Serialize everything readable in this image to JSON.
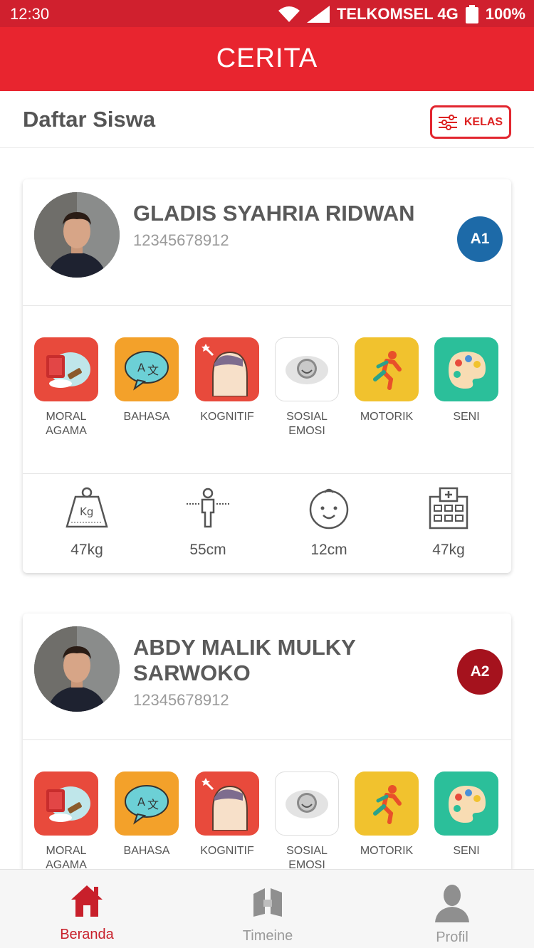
{
  "status": {
    "time": "12:30",
    "carrier": "TELKOMSEL 4G",
    "battery": "100%"
  },
  "app": {
    "title": "CERITA"
  },
  "header": {
    "title": "Daftar Siswa",
    "filter_label": "KELAS"
  },
  "colors": {
    "primary": "#e8252f",
    "badge_a1": "#1d6aa8",
    "badge_a2": "#a5121d"
  },
  "aspects": [
    {
      "label": "MORAL AGAMA",
      "icon": "moral-agama-icon"
    },
    {
      "label": "BAHASA",
      "icon": "bahasa-icon"
    },
    {
      "label": "KOGNITIF",
      "icon": "kognitif-icon"
    },
    {
      "label": "SOSIAL EMOSI",
      "icon": "sosial-emosi-icon"
    },
    {
      "label": "MOTORIK",
      "icon": "motorik-icon"
    },
    {
      "label": "SENI",
      "icon": "seni-icon"
    }
  ],
  "students": [
    {
      "name": "GLADIS SYAHRIA RIDWAN",
      "number": "12345678912",
      "class": "A1",
      "stats": {
        "weight": "47kg",
        "height": "55cm",
        "head": "12cm",
        "health": "47kg"
      }
    },
    {
      "name": "ABDY MALIK MULKY SARWOKO",
      "number": "12345678912",
      "class": "A2"
    }
  ],
  "nav": {
    "home": "Beranda",
    "timeline": "Timeine",
    "profile": "Profil"
  }
}
